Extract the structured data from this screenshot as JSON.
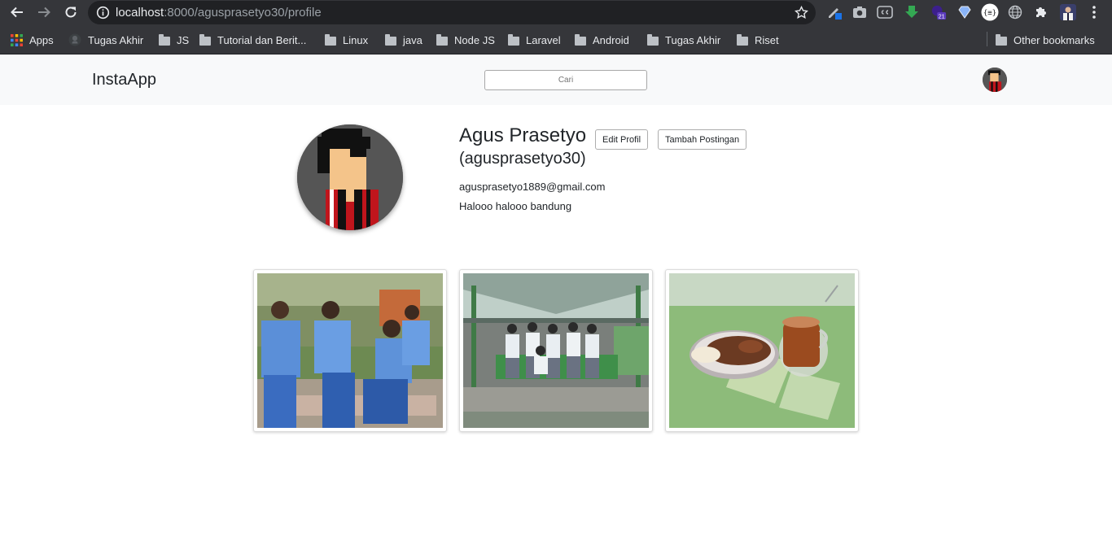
{
  "browser": {
    "url_host": "localhost",
    "url_path": ":8000/agusprasetyo30/profile",
    "extension_badge": "21",
    "bookmarks": [
      {
        "label": "Apps",
        "icon": "apps-grid-icon"
      },
      {
        "label": "Tugas Akhir",
        "icon": "github-icon"
      },
      {
        "label": "JS",
        "icon": "folder-icon"
      },
      {
        "label": "Tutorial dan Berit...",
        "icon": "folder-icon"
      },
      {
        "label": "Linux",
        "icon": "folder-icon"
      },
      {
        "label": "java",
        "icon": "folder-icon"
      },
      {
        "label": "Node JS",
        "icon": "folder-icon"
      },
      {
        "label": "Laravel",
        "icon": "folder-icon"
      },
      {
        "label": "Android",
        "icon": "folder-icon"
      },
      {
        "label": "Tugas Akhir",
        "icon": "folder-icon"
      },
      {
        "label": "Riset",
        "icon": "folder-icon"
      }
    ],
    "other_bookmarks": "Other bookmarks"
  },
  "navbar": {
    "brand": "InstaApp",
    "search_placeholder": "Cari"
  },
  "profile": {
    "name": "Agus Prasetyo",
    "username": "(agusprasetyo30)",
    "email": "agusprasetyo1889@gmail.com",
    "bio": "Halooo halooo bandung",
    "edit_button": "Edit Profil",
    "add_post_button": "Tambah Postingan"
  },
  "posts": [
    {
      "subject": "students-sitting-photo"
    },
    {
      "subject": "group-under-pavilion-photo"
    },
    {
      "subject": "meal-and-tea-photo"
    }
  ],
  "colors": {
    "chrome_dark": "#35363a",
    "omnibox": "#202124",
    "navbar_bg": "#f8f9fa"
  }
}
